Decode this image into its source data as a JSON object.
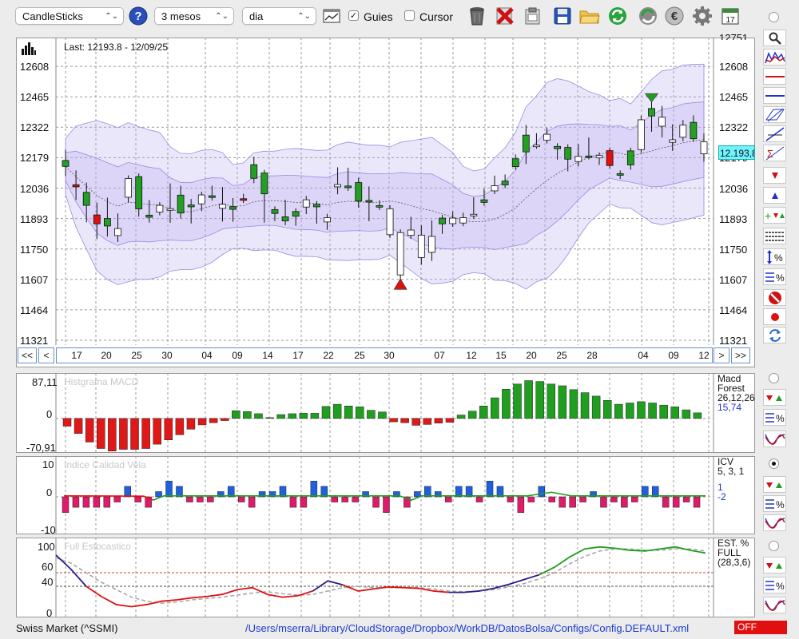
{
  "toolbar": {
    "chart_type": "CandleSticks",
    "period": "3 mesos",
    "interval": "dia",
    "guides_label": "Guies",
    "guides_checked": true,
    "cursor_label": "Cursor",
    "cursor_checked": false,
    "calendar_day": "17"
  },
  "main": {
    "last_label": "Last: 12193.8 - 12/09/25",
    "current_price": "12.193,8",
    "y_ticks": [
      "12751",
      "12608",
      "12465",
      "12322",
      "12179",
      "12036",
      "11893",
      "11750",
      "11607",
      "11464",
      "11321"
    ],
    "x_ticks": [
      "17",
      "20",
      "25",
      "30",
      "04",
      "09",
      "14",
      "17",
      "22",
      "25",
      "30",
      "07",
      "12",
      "15",
      "20",
      "25",
      "28",
      "04",
      "09",
      "12"
    ],
    "nav_first": "<<",
    "nav_prev": "<",
    "nav_next": ">",
    "nav_last": ">>"
  },
  "macd": {
    "title": "Histgrama MACD",
    "y_ticks": [
      "87,11",
      "0",
      "-70,91"
    ],
    "legend_name": "Macd",
    "legend_sub": "Forest",
    "legend_params": "26,12,26",
    "legend_value": "15,74"
  },
  "icv": {
    "title": "Indice Calidad Vela",
    "y_ticks": [
      "10",
      "0",
      "-10"
    ],
    "legend_name": "ICV",
    "legend_params": "5, 3, 1",
    "legend_v1": "1",
    "legend_v2": "-2"
  },
  "stoch": {
    "title": "Full Estocastico",
    "y_ticks": [
      "100",
      "60",
      "40",
      "0"
    ],
    "legend_name": "EST. %",
    "legend_sub": "FULL",
    "legend_params": "(28,3,6)"
  },
  "status": {
    "symbol": "Swiss Market (^SSMI)",
    "config_path": "/Users/mserra/Library/CloudStorage/Dropbox/WorkDB/DatosBolsa/Configs/Config.DEFAULT.xml",
    "off_label": "OFF"
  },
  "colors": {
    "up": "#22a022",
    "down": "#e01010",
    "band": "#b7aaf0",
    "stoch_k": "#1e9e1e",
    "stoch_k_red": "#e01010",
    "stoch_k_blue": "#2a1d8a",
    "stoch_d": "#a8a8a8",
    "macd_pos": "#1f9e1f",
    "macd_neg": "#e01818",
    "icv_pos": "#1f5fe0",
    "icv_neg": "#e01a6a"
  },
  "chart_data": [
    {
      "type": "candlestick",
      "title": "",
      "y_range": [
        11321,
        12751
      ],
      "x_labels": [
        "17",
        "20",
        "25",
        "30",
        "04",
        "09",
        "14",
        "17",
        "22",
        "25",
        "30",
        "07",
        "12",
        "15",
        "20",
        "25",
        "28",
        "04",
        "09",
        "12"
      ],
      "ohlc": [
        [
          12166,
          12201,
          12108,
          12138
        ],
        [
          12052,
          12104,
          11996,
          12042
        ],
        [
          12016,
          12047,
          11890,
          11955
        ],
        [
          11910,
          11953,
          11812,
          11868
        ],
        [
          11893,
          11976,
          11823,
          11858
        ],
        [
          11813,
          11902,
          11798,
          11846
        ],
        [
          11993,
          12021,
          11983,
          12081
        ],
        [
          12090,
          12052,
          11917,
          11938
        ],
        [
          11909,
          11965,
          11889,
          11899
        ],
        [
          11923,
          11953,
          11930,
          11955
        ],
        [
          11932,
          12043,
          11888,
          11940
        ],
        [
          12003,
          12032,
          11908,
          11919
        ],
        [
          11957,
          11970,
          11885,
          11948
        ],
        [
          11962,
          11976,
          11943,
          12004
        ],
        [
          12000,
          12032,
          12015,
          11992
        ],
        [
          11941,
          12026,
          11894,
          11960
        ],
        [
          11949,
          11974,
          11893,
          11936
        ],
        [
          11986,
          11981,
          11994,
          11985
        ],
        [
          12146,
          12168,
          12074,
          12082
        ],
        [
          12107,
          11889,
          12089,
          12009
        ],
        [
          11917,
          11901,
          11896,
          11935
        ],
        [
          11901,
          11966,
          11877,
          11882
        ],
        [
          11926,
          11874,
          11925,
          11904
        ],
        [
          11947,
          11984,
          11929,
          11981
        ],
        [
          11948,
          11952,
          11884,
          11960
        ],
        [
          11877,
          11900,
          11855,
          11897
        ],
        [
          12042,
          12119,
          12022,
          12053
        ],
        [
          12046,
          12091,
          12117,
          12038
        ],
        [
          11975,
          12070,
          11959,
          12062
        ],
        [
          11978,
          12029,
          11895,
          11972
        ],
        [
          11954,
          11962,
          11964,
          11948
        ],
        [
          11817,
          11941,
          11825,
          11939
        ],
        [
          11628,
          11778,
          11605,
          11827
        ],
        [
          11814,
          11886,
          11813,
          11839
        ],
        [
          11710,
          11847,
          11691,
          11815
        ],
        [
          11734,
          11870,
          11709,
          11809
        ],
        [
          11868,
          11889,
          11836,
          11895
        ],
        [
          11869,
          11896,
          11912,
          11895
        ],
        [
          11872,
          11906,
          11899,
          11897
        ],
        [
          11906,
          11978,
          11922,
          11913
        ],
        [
          11981,
          12018,
          11975,
          11969
        ],
        [
          12023,
          12064,
          12080,
          12047
        ],
        [
          12069,
          12085,
          12074,
          12051
        ],
        [
          12174,
          12179,
          12143,
          12137
        ],
        [
          12206,
          12317,
          12164,
          12285
        ],
        [
          12236,
          12279,
          12270,
          12238
        ],
        [
          12261,
          12305,
          12275,
          12289
        ],
        [
          12232,
          12212,
          12185,
          12221
        ],
        [
          12227,
          12181,
          12130,
          12172
        ],
        [
          12161,
          12228,
          12153,
          12185
        ],
        [
          12187,
          12209,
          12259,
          12186
        ],
        [
          12178,
          12160,
          12166,
          12189
        ],
        [
          12212,
          12161,
          12196,
          12142
        ],
        [
          12104,
          12094,
          12098,
          12097
        ],
        [
          12211,
          12207,
          12137,
          12145
        ],
        [
          12217,
          12362,
          12238,
          12357
        ],
        [
          12375,
          12425,
          12316,
          12410
        ],
        [
          12327,
          12407,
          12289,
          12369
        ],
        [
          12251,
          12320,
          12226,
          12263
        ],
        [
          12275,
          12341,
          12272,
          12332
        ],
        [
          12345,
          12363,
          12312,
          12268
        ],
        [
          12197,
          12278,
          12175,
          12254
        ]
      ],
      "annotations": [
        "buy-signal at low",
        "sell-signal at high"
      ]
    },
    {
      "type": "bar",
      "title": "Histgrama MACD",
      "y_range": [
        -70.91,
        87.11
      ],
      "values": [
        -18,
        -35,
        -55,
        -70,
        -76,
        -72,
        -72,
        -70,
        -60,
        -50,
        -38,
        -25,
        -15,
        -10,
        -5,
        18,
        16,
        11,
        2,
        9,
        11,
        12,
        12,
        28,
        33,
        29,
        27,
        19,
        15,
        -8,
        -10,
        -16,
        -14,
        -11,
        -9,
        8,
        17,
        29,
        48,
        68,
        80,
        88,
        86,
        80,
        76,
        67,
        60,
        52,
        42,
        33,
        36,
        39,
        36,
        31,
        27,
        20,
        13
      ],
      "colors": "positive green / negative red"
    },
    {
      "type": "bar",
      "title": "Indice Calidad Vela",
      "y_range": [
        -10,
        10
      ],
      "values": [
        -3,
        -2,
        -2,
        -2,
        -2,
        -1,
        2,
        -1,
        -2,
        1,
        3,
        2,
        -1,
        -1,
        -1,
        1,
        2,
        -1,
        -2,
        1,
        1,
        2,
        -2,
        -2,
        3,
        2,
        -1,
        -1,
        -1,
        1,
        -2,
        -3,
        1,
        -2,
        1,
        2,
        1,
        -1,
        2,
        2,
        -1,
        3,
        2,
        -1,
        -3,
        -1,
        2,
        -1,
        -2,
        -2,
        -1,
        1,
        -2,
        -1,
        -2,
        -1,
        2,
        2,
        -2,
        -2,
        -1,
        -2
      ],
      "signal_line": "green above / red below"
    },
    {
      "type": "line",
      "title": "Full Estocastico",
      "y_range": [
        0,
        100
      ],
      "reference_lines": [
        60,
        40
      ],
      "series": [
        {
          "name": "",
          "values": [
            86,
            65,
            40,
            25,
            13,
            10,
            13,
            18,
            20,
            23,
            25,
            28,
            35,
            38,
            28,
            24,
            26,
            33,
            48,
            42,
            33,
            36,
            39,
            38,
            37,
            33,
            31,
            31,
            33,
            37,
            43,
            50,
            57,
            68,
            83,
            95,
            98,
            96,
            93,
            92,
            95,
            98,
            93,
            89
          ]
        },
        {
          "name": "",
          "values": [
            82,
            74,
            60,
            46,
            35,
            24,
            18,
            15,
            17,
            20,
            22,
            24,
            27,
            30,
            32,
            29,
            27,
            28,
            33,
            38,
            40,
            38,
            38,
            38,
            38,
            36,
            33,
            32,
            33,
            35,
            39,
            44,
            51,
            60,
            73,
            84,
            92,
            95,
            95,
            93,
            93,
            95,
            95,
            92
          ]
        }
      ]
    }
  ]
}
